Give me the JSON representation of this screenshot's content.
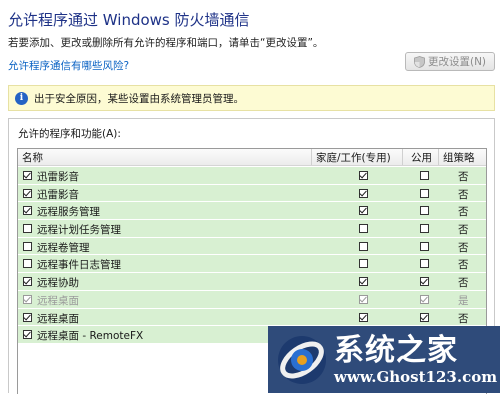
{
  "header": {
    "title": "允许程序通过 Windows 防火墙通信",
    "subtitle": "若要添加、更改或删除所有允许的程序和端口，请单击“更改设置”。",
    "risk_link": "允许程序通信有哪些风险?",
    "change_button": "更改设置(N)"
  },
  "infobar": {
    "icon": "info-icon",
    "text": "出于安全原因，某些设置由系统管理员管理。"
  },
  "group": {
    "label": "允许的程序和功能(A):",
    "columns": {
      "name": "名称",
      "home": "家庭/工作(专用)",
      "public": "公用",
      "policy": "组策略"
    },
    "rows": [
      {
        "name": "迅雷影音",
        "checked": true,
        "home": true,
        "public": false,
        "policy": "否",
        "disabled": false
      },
      {
        "name": "迅雷影音",
        "checked": true,
        "home": true,
        "public": false,
        "policy": "否",
        "disabled": false
      },
      {
        "name": "远程服务管理",
        "checked": true,
        "home": true,
        "public": false,
        "policy": "否",
        "disabled": false
      },
      {
        "name": "远程计划任务管理",
        "checked": false,
        "home": false,
        "public": false,
        "policy": "否",
        "disabled": false
      },
      {
        "name": "远程卷管理",
        "checked": false,
        "home": false,
        "public": false,
        "policy": "否",
        "disabled": false
      },
      {
        "name": "远程事件日志管理",
        "checked": false,
        "home": false,
        "public": false,
        "policy": "否",
        "disabled": false
      },
      {
        "name": "远程协助",
        "checked": true,
        "home": true,
        "public": true,
        "policy": "否",
        "disabled": false
      },
      {
        "name": "远程桌面",
        "checked": true,
        "home": true,
        "public": true,
        "policy": "是",
        "disabled": true
      },
      {
        "name": "远程桌面",
        "checked": true,
        "home": true,
        "public": true,
        "policy": "否",
        "disabled": false
      },
      {
        "name": "远程桌面 - RemoteFX",
        "checked": true,
        "home": true,
        "public": true,
        "policy": "否",
        "disabled": false
      }
    ]
  },
  "watermark": {
    "main": "系统之家",
    "url": "www.Ghost123.com"
  }
}
